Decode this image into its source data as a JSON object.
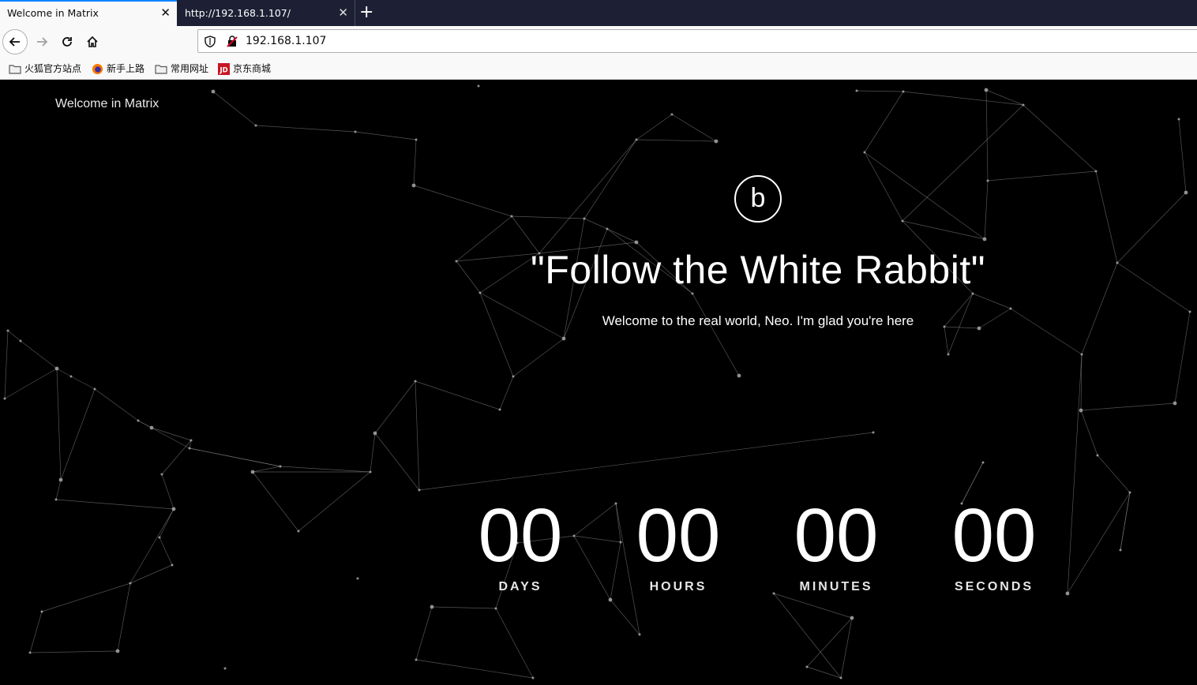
{
  "browser": {
    "tabs": [
      {
        "title": "Welcome in Matrix",
        "active": true
      },
      {
        "title": "http://192.168.1.107/",
        "active": false
      }
    ],
    "url": "192.168.1.107",
    "bookmarks": [
      "火狐官方站点",
      "新手上路",
      "常用网址",
      "京东商城"
    ],
    "bookmark_icons": [
      "folder-icon",
      "firefox-icon",
      "folder-icon",
      "jd-icon"
    ]
  },
  "page": {
    "brand": "Welcome in Matrix",
    "logo_letter": "b",
    "headline": "\"Follow the White Rabbit\"",
    "subline": "Welcome to the real world, Neo. I'm glad you're here",
    "countdown": [
      {
        "value": "00",
        "label": "DAYS"
      },
      {
        "value": "00",
        "label": "HOURS"
      },
      {
        "value": "00",
        "label": "MINUTES"
      },
      {
        "value": "00",
        "label": "SECONDS"
      }
    ]
  },
  "colors": {
    "background": "#000000",
    "tabstrip": "#1d2034",
    "accent": "#0a84ff",
    "network": "#9a9a9a"
  }
}
